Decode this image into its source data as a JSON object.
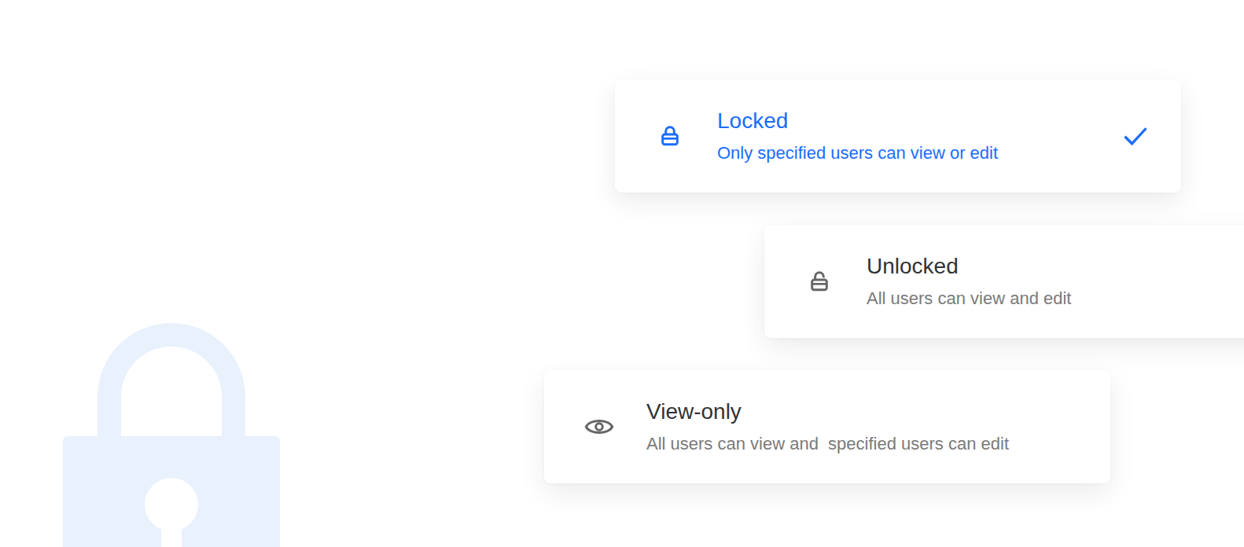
{
  "options": [
    {
      "title": "Locked",
      "description": "Only specified users can view or edit",
      "kind": "locked",
      "selected": true
    },
    {
      "title": "Unlocked",
      "description": "All users can view and edit",
      "kind": "unlocked",
      "selected": false
    },
    {
      "title": "View-only",
      "description": "All users can view and  specified users can edit",
      "kind": "view",
      "selected": false
    }
  ]
}
